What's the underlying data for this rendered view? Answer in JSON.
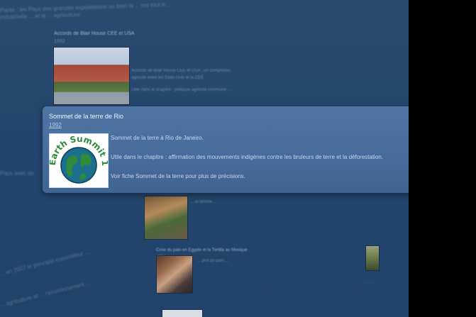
{
  "popup": {
    "title": "Sommet de la terre de Rio",
    "year": "1992",
    "description": "Sommet de la terre à Rio de Janeiro.",
    "chapter_usage": "Utile dans le chapitre : affirmation des mouvements indigènes contre les bruleurs de terre et la déforestation.",
    "more_info": "Voir fiche Sommet de la terre pour plus de précisions.",
    "logo_text": "Rio Earth Summit 1992"
  },
  "background": {
    "entry1_title": "Accords de Blair House CEE et USA",
    "entry1_year": "1992",
    "entry3_title": "Crise du pain en Égypte et la Tortilla au Mexique",
    "entry3_year": "2007",
    "left_fragment1": "Pays avec de",
    "left_fragment2": "... en 2007 le principal exportateur ...",
    "left_fragment3": "... agriculture et ... l'environnement ..."
  },
  "colors": {
    "background": "#24466e",
    "popup": "#4a70a0",
    "side": "#000000"
  }
}
